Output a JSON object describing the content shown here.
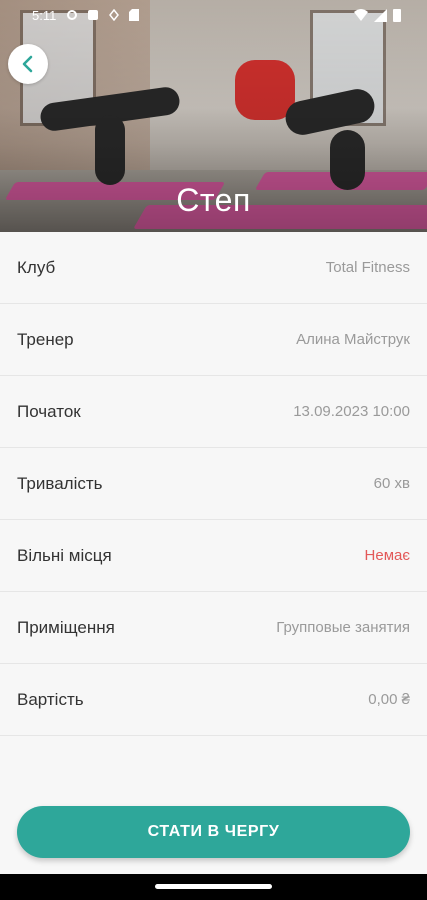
{
  "status_bar": {
    "time": "5:11",
    "left_icons": [
      "settings-icon",
      "play-protect-icon",
      "location-icon",
      "sd-card-icon"
    ],
    "right_icons": [
      "wifi-icon",
      "signal-icon",
      "battery-icon"
    ]
  },
  "hero": {
    "title": "Степ"
  },
  "details": [
    {
      "label": "Клуб",
      "value": "Total Fitness"
    },
    {
      "label": "Тренер",
      "value": "Алина Майструк"
    },
    {
      "label": "Початок",
      "value": "13.09.2023 10:00"
    },
    {
      "label": "Тривалість",
      "value": "60 хв"
    },
    {
      "label": "Вільні місця",
      "value": "Немає"
    },
    {
      "label": "Приміщення",
      "value": "Групповые занятия"
    },
    {
      "label": "Вартість",
      "value": "0,00 ₴"
    }
  ],
  "action": {
    "queue_label": "СТАТИ В ЧЕРГУ"
  },
  "colors": {
    "accent": "#2ea79a",
    "alert": "#e35858"
  }
}
